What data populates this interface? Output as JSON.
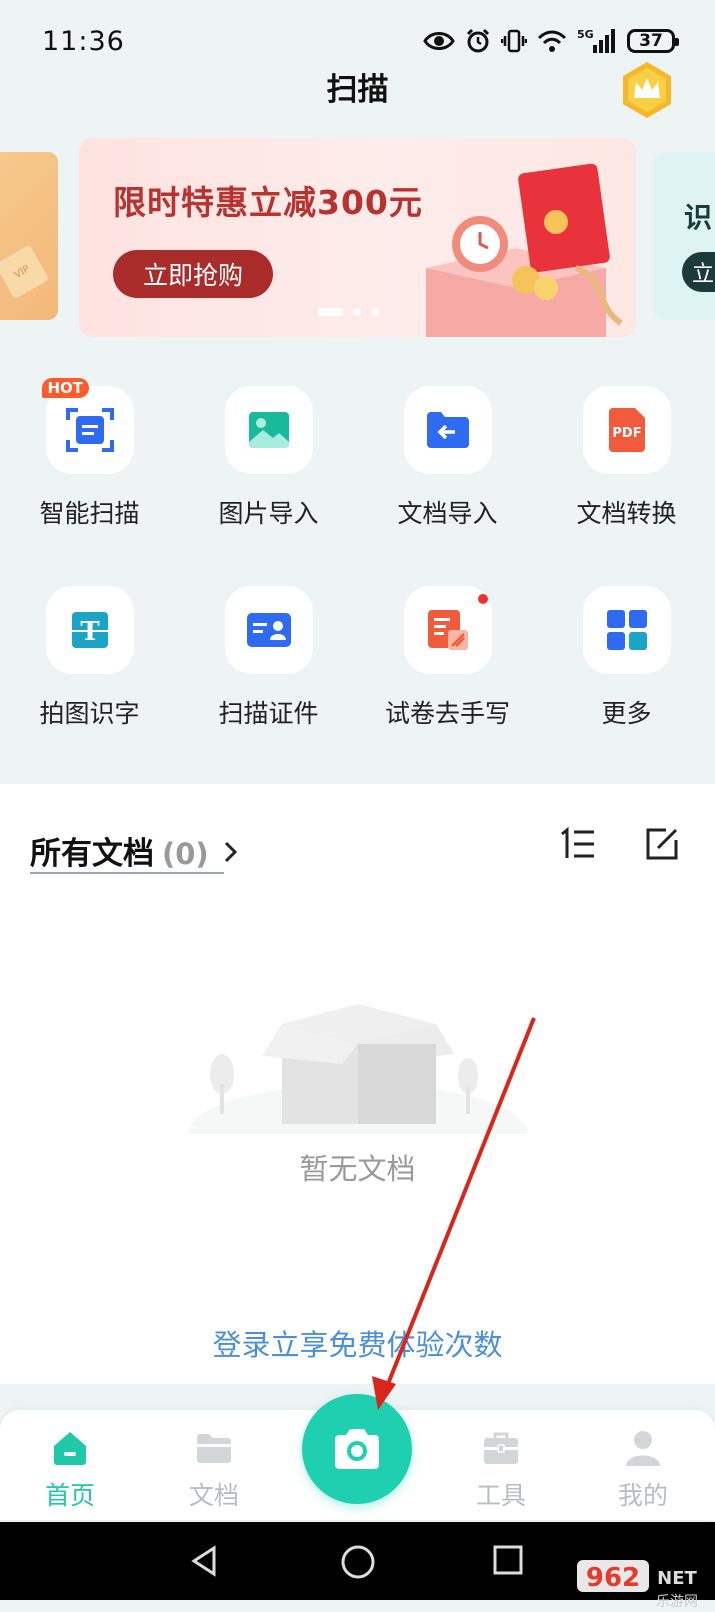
{
  "status_bar": {
    "time": "11:36",
    "network": "5G",
    "battery": "37"
  },
  "header": {
    "title": "扫描"
  },
  "banner": {
    "title": "限时特惠立减300元",
    "button": "立即抢购",
    "side_left_text": "VIP",
    "side_right_title": "识",
    "side_right_button": "立"
  },
  "tools": [
    {
      "label": "智能扫描",
      "badge": "HOT",
      "icon": "smart-scan-icon"
    },
    {
      "label": "图片导入",
      "icon": "image-import-icon"
    },
    {
      "label": "文档导入",
      "icon": "doc-import-icon"
    },
    {
      "label": "文档转换",
      "icon": "pdf-convert-icon",
      "icon_text": "PDF"
    },
    {
      "label": "拍图识字",
      "icon": "ocr-text-icon",
      "icon_text": "T"
    },
    {
      "label": "扫描证件",
      "icon": "id-card-icon"
    },
    {
      "label": "试卷去手写",
      "icon": "erase-handwriting-icon"
    },
    {
      "label": "更多",
      "icon": "more-grid-icon"
    }
  ],
  "documents": {
    "title": "所有文档",
    "count": "(0)",
    "empty_text": "暂无文档",
    "login_link": "登录立享免费体验次数"
  },
  "bottom_nav": [
    {
      "label": "首页",
      "active": true
    },
    {
      "label": "文档",
      "active": false
    },
    {
      "label": "工具",
      "active": false
    },
    {
      "label": "我的",
      "active": false
    }
  ],
  "watermark": {
    "brand": "962",
    "suffix": "NET",
    "sub": "乐游网"
  },
  "colors": {
    "accent": "#1fd0b0",
    "banner_red": "#b8332f",
    "link": "#4a90d9",
    "annotation_arrow": "#d9261c"
  }
}
